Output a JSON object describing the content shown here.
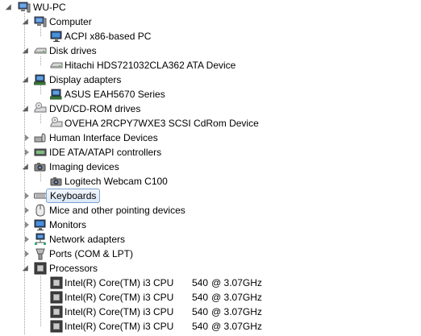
{
  "root": {
    "label": "WU-PC",
    "icon": "computer-icon"
  },
  "categories": [
    {
      "label": "Computer",
      "icon": "computer-icon",
      "expanded": true,
      "children": [
        {
          "label": "ACPI x86-based PC",
          "icon": "monitor-icon"
        }
      ]
    },
    {
      "label": "Disk drives",
      "icon": "disk-drive-icon",
      "expanded": true,
      "children": [
        {
          "label": "Hitachi HDS721032CLA362 ATA Device",
          "icon": "disk-drive-icon"
        }
      ]
    },
    {
      "label": "Display adapters",
      "icon": "display-adapter-icon",
      "expanded": true,
      "children": [
        {
          "label": "ASUS EAH5670 Series",
          "icon": "display-adapter-icon"
        }
      ]
    },
    {
      "label": "DVD/CD-ROM drives",
      "icon": "cd-drive-icon",
      "expanded": true,
      "children": [
        {
          "label": "OVEHA 2RCPY7WXE3 SCSI CdRom Device",
          "icon": "cd-drive-icon"
        }
      ]
    },
    {
      "label": "Human Interface Devices",
      "icon": "hid-icon",
      "expanded": false,
      "children": []
    },
    {
      "label": "IDE ATA/ATAPI controllers",
      "icon": "ide-controller-icon",
      "expanded": false,
      "children": []
    },
    {
      "label": "Imaging devices",
      "icon": "camera-icon",
      "expanded": true,
      "children": [
        {
          "label": "Logitech Webcam C100",
          "icon": "camera-icon"
        }
      ]
    },
    {
      "label": "Keyboards",
      "icon": "keyboard-icon",
      "expanded": false,
      "selected": true,
      "children": []
    },
    {
      "label": "Mice and other pointing devices",
      "icon": "mouse-icon",
      "expanded": false,
      "children": []
    },
    {
      "label": "Monitors",
      "icon": "monitor-icon",
      "expanded": false,
      "children": []
    },
    {
      "label": "Network adapters",
      "icon": "network-icon",
      "expanded": false,
      "children": []
    },
    {
      "label": "Ports (COM & LPT)",
      "icon": "port-icon",
      "expanded": false,
      "children": []
    },
    {
      "label": "Processors",
      "icon": "processor-icon",
      "expanded": true,
      "children": [
        {
          "label": "Intel(R) Core(TM) i3 CPU",
          "model": "540",
          "speed": "@ 3.07GHz",
          "icon": "processor-icon"
        },
        {
          "label": "Intel(R) Core(TM) i3 CPU",
          "model": "540",
          "speed": "@ 3.07GHz",
          "icon": "processor-icon"
        },
        {
          "label": "Intel(R) Core(TM) i3 CPU",
          "model": "540",
          "speed": "@ 3.07GHz",
          "icon": "processor-icon"
        },
        {
          "label": "Intel(R) Core(TM) i3 CPU",
          "model": "540",
          "speed": "@ 3.07GHz",
          "icon": "processor-icon"
        }
      ]
    }
  ],
  "colors": {
    "selection_border": "#7da2ce",
    "selection_fill": "#dbe8f8",
    "tree_line": "#a0a0a0"
  }
}
